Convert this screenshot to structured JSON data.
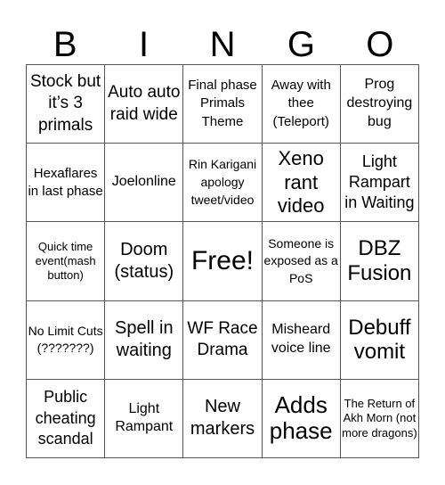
{
  "header": {
    "letters": [
      "B",
      "I",
      "N",
      "G",
      "O"
    ]
  },
  "cells": [
    [
      "Stock but it’s 3 primals",
      "Auto auto raid wide",
      "Final phase Primals Theme",
      "Away with thee (Teleport)",
      "Prog destroying bug"
    ],
    [
      "Hexaflares in last phase",
      "Joelonline",
      "Rin Karigani apology tweet/video",
      "Xeno rant video",
      "Light Rampart in Waiting"
    ],
    [
      "Quick time event(mash button)",
      "Doom (status)",
      "Free!",
      "Someone is exposed as a PoS",
      "DBZ Fusion"
    ],
    [
      "No Limit Cuts (???????)",
      "Spell in waiting",
      "WF Race Drama",
      "Misheard voice line",
      "Debuff vomit"
    ],
    [
      "Public cheating scandal",
      "Light Rampant",
      "New markers",
      "Adds phase",
      "The Return of Akh Morn (not more dragons)"
    ]
  ]
}
